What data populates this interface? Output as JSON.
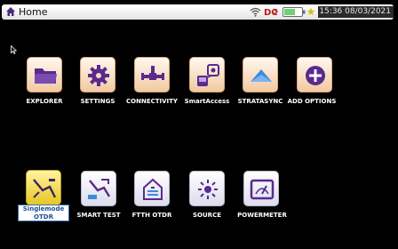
{
  "header": {
    "title": "Home",
    "clock": "15:36 08/03/2021"
  },
  "row1": [
    {
      "label": "EXPLORER",
      "icon": "folder-icon"
    },
    {
      "label": "SETTINGS",
      "icon": "gear-icon"
    },
    {
      "label": "CONNECTIVITY",
      "icon": "connectivity-icon"
    },
    {
      "label": "SmartAccess",
      "icon": "smartaccess-icon"
    },
    {
      "label": "STRATASYNC",
      "icon": "stratasync-icon"
    },
    {
      "label": "ADD OPTIONS",
      "icon": "add-options-icon"
    }
  ],
  "row2": [
    {
      "label_line1": "Singlemode",
      "label_line2": "OTDR",
      "icon": "otdr-icon",
      "selected": true
    },
    {
      "label": "SMART TEST",
      "icon": "smart-test-icon"
    },
    {
      "label": "FTTH OTDR",
      "icon": "ftth-otdr-icon"
    },
    {
      "label": "SOURCE",
      "icon": "source-icon"
    },
    {
      "label": "POWERMETER",
      "icon": "powermeter-icon"
    }
  ],
  "colors": {
    "accent_purple": "#5a2a8c",
    "selected_yellow": "#e8c623",
    "label_blue": "#1d4f93"
  }
}
